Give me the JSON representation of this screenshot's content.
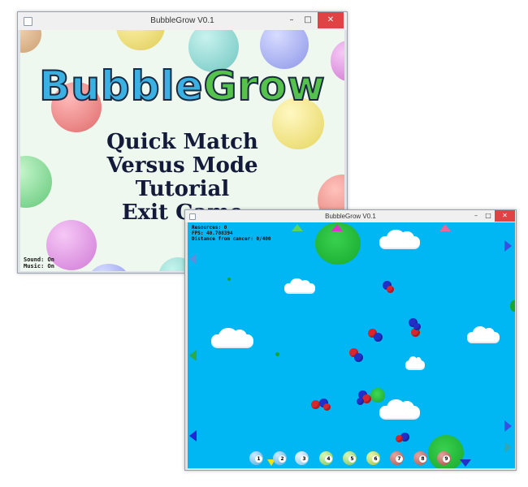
{
  "menu_window": {
    "title": "BubbleGrow V0.1",
    "controls": {
      "minimize": "–",
      "maximize": "□",
      "close": "✕"
    },
    "logo": {
      "part1": "Bubble",
      "part2": "Grow"
    },
    "menu_items": [
      "Quick Match",
      "Versus Mode",
      "Tutorial",
      "Exit Game"
    ],
    "status": {
      "sound": "Sound: On",
      "music": "Music: On"
    }
  },
  "game_window": {
    "title": "BubbleGrow V0.1",
    "controls": {
      "minimize": "–",
      "maximize": "□",
      "close": "✕"
    },
    "hud": {
      "resources": "Resources: 0",
      "fps": "FPS: 40.708394",
      "distance": "Distance from cancer: 0/400"
    },
    "toolbar_slots": [
      "1",
      "2",
      "3",
      "4",
      "5",
      "6",
      "7",
      "8",
      "9"
    ]
  },
  "colors": {
    "game_background": "#00b6f3",
    "menu_background": "#eef8ee",
    "close_button": "#e04343",
    "logo_blue": "#3ab0e3",
    "logo_green": "#55c24d"
  }
}
